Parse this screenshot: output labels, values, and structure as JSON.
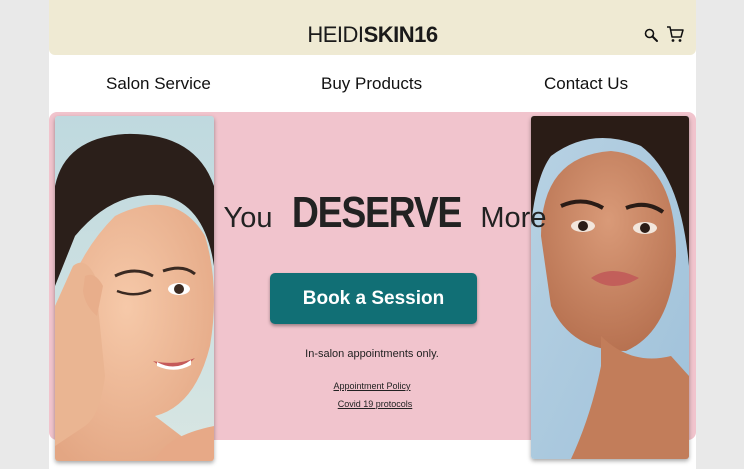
{
  "header": {
    "logo_light": "HEIDI",
    "logo_bold": "SKIN16",
    "search_icon": "search-icon",
    "cart_icon": "cart-icon"
  },
  "nav": {
    "items": [
      {
        "label": "Salon Service"
      },
      {
        "label": "Buy Products"
      },
      {
        "label": "Contact Us"
      }
    ]
  },
  "hero": {
    "headline_pre": "You",
    "headline_main": "DESERVE",
    "headline_post": "More",
    "cta_label": "Book a Session",
    "note": "In-salon appointments only.",
    "links": [
      {
        "label": "Appointment Policy"
      },
      {
        "label": "Covid 19 protocols"
      }
    ]
  },
  "colors": {
    "header_bg": "#efead3",
    "hero_bg": "#f1c4cd",
    "cta_bg": "#116f75",
    "page_bg": "#e9e9e9"
  }
}
